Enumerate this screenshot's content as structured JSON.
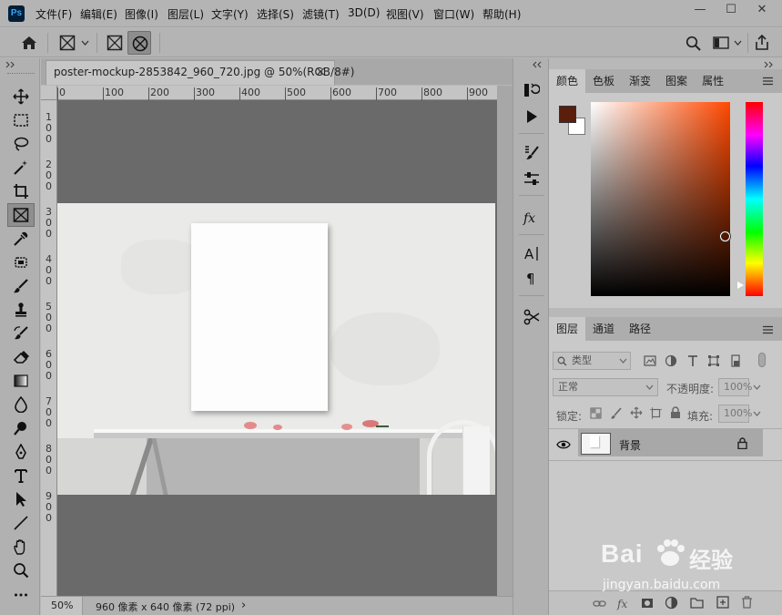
{
  "app": {
    "logo": "Ps"
  },
  "menu": [
    "文件(F)",
    "编辑(E)",
    "图像(I)",
    "图层(L)",
    "文字(Y)",
    "选择(S)",
    "滤镜(T)",
    "3D(D)",
    "视图(V)",
    "窗口(W)",
    "帮助(H)"
  ],
  "window_controls": {
    "minimize": "—",
    "maximize": "☐",
    "close": "✕"
  },
  "document": {
    "tab_title": "poster-mockup-2853842_960_720.jpg @ 50%(RGB/8#)",
    "close_glyph": "×",
    "ruler_top_labels": [
      "0",
      "100",
      "200",
      "300",
      "400",
      "500",
      "600",
      "700",
      "800",
      "900"
    ],
    "ruler_left_labels": [
      "1",
      "2",
      "3",
      "4",
      "5",
      "6",
      "7",
      "8",
      "9"
    ],
    "zoom": "50%",
    "size_info": "960 像素 x 640 像素 (72 ppi)",
    "status_arrow": "›"
  },
  "color_panel": {
    "tabs": [
      "颜色",
      "色板",
      "渐变",
      "图案",
      "属性"
    ],
    "foreground_color": "#5a1e0c",
    "background_color": "#ffffff",
    "picker_hue_color": "#ff4800"
  },
  "layers_panel": {
    "tabs": [
      "图层",
      "通道",
      "路径"
    ],
    "filter_kind": "类型",
    "blend_mode": "正常",
    "opacity_label": "不透明度:",
    "opacity_value": "100%",
    "lock_label": "锁定:",
    "fill_label": "填充:",
    "fill_value": "100%",
    "layers": [
      {
        "name": "背景",
        "visible": true,
        "locked": true
      }
    ]
  },
  "watermark": {
    "brand": "Bai",
    "brand2": "经验",
    "url": "jingyan.baidu.com"
  }
}
